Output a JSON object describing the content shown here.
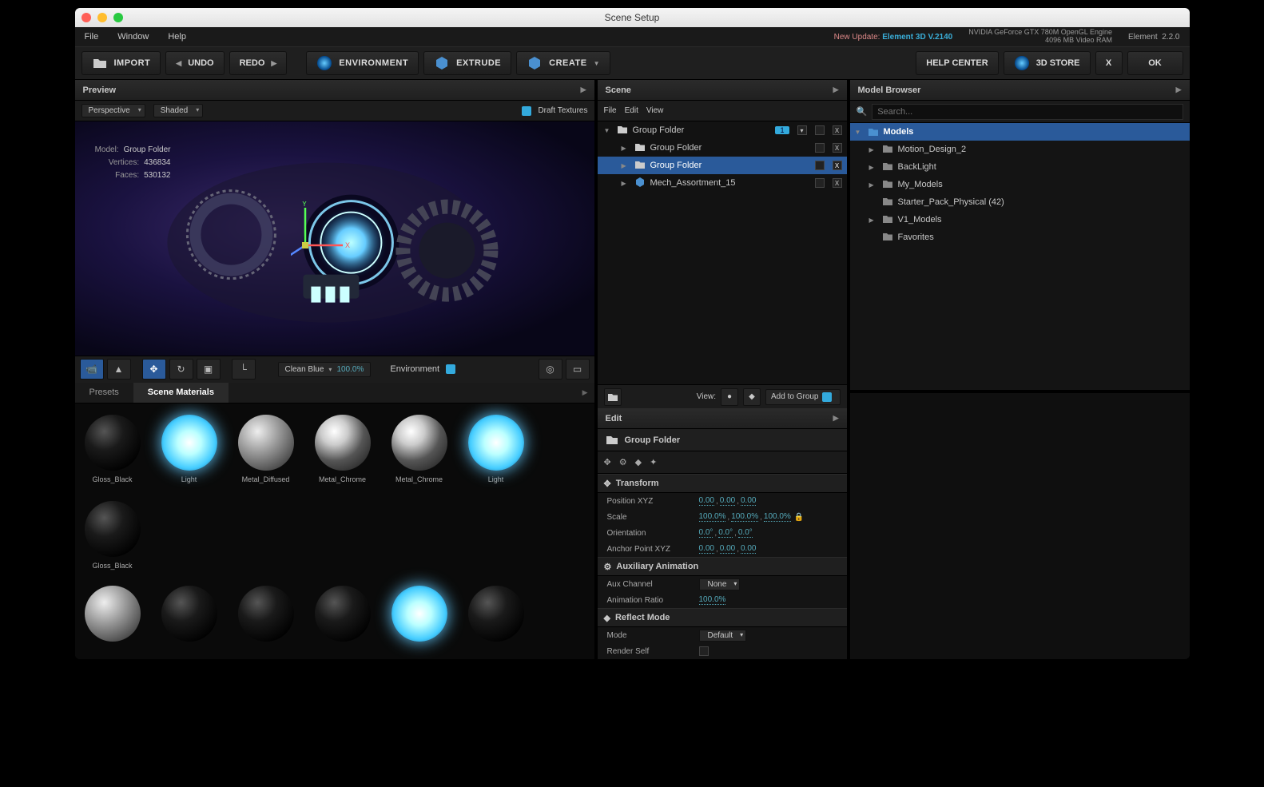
{
  "titlebar": {
    "title": "Scene Setup"
  },
  "menubar": {
    "items": [
      "File",
      "Window",
      "Help"
    ],
    "update_prefix": "New Update:",
    "update_link": "Element 3D V.2140",
    "gpu_line1": "NVIDIA GeForce GTX 780M OpenGL Engine",
    "gpu_line2": "4096 MB Video RAM",
    "app_name": "Element",
    "app_ver": "2.2.0"
  },
  "toolbar": {
    "import": "IMPORT",
    "undo": "UNDO",
    "redo": "REDO",
    "environment": "ENVIRONMENT",
    "extrude": "EXTRUDE",
    "create": "CREATE",
    "help": "HELP CENTER",
    "store": "3D STORE",
    "x": "X",
    "ok": "OK"
  },
  "preview": {
    "title": "Preview",
    "view_mode": "Perspective",
    "shade_mode": "Shaded",
    "draft_tex": "Draft Textures",
    "info": {
      "model_lbl": "Model:",
      "model": "Group Folder",
      "verts_lbl": "Vertices:",
      "verts": "436834",
      "faces_lbl": "Faces:",
      "faces": "530132"
    },
    "env_preset": "Clean Blue",
    "env_pct": "100.0%",
    "env_label": "Environment"
  },
  "materials": {
    "tab_presets": "Presets",
    "tab_scene": "Scene Materials",
    "row1": [
      "Gloss_Black",
      "Light",
      "Metal_Diffused",
      "Metal_Chrome",
      "Metal_Chrome",
      "Light",
      "Gloss_Black"
    ],
    "row2": [
      "",
      "",
      "",
      "",
      "",
      "",
      ""
    ]
  },
  "scene": {
    "title": "Scene",
    "menus": [
      "File",
      "Edit",
      "View"
    ],
    "tree": [
      {
        "label": "Group Folder",
        "depth": 0,
        "expanded": true,
        "badge": "1",
        "folder": true
      },
      {
        "label": "Group Folder",
        "depth": 1,
        "folder": true
      },
      {
        "label": "Group Folder",
        "depth": 1,
        "folder": true,
        "selected": true
      },
      {
        "label": "Mech_Assortment_15",
        "depth": 1,
        "cube": true
      }
    ],
    "view_label": "View:",
    "add_to_group": "Add to Group"
  },
  "edit": {
    "title": "Edit",
    "header": "Group Folder",
    "transform": {
      "title": "Transform",
      "pos_lbl": "Position XYZ",
      "pos": [
        "0.00",
        "0.00",
        "0.00"
      ],
      "scale_lbl": "Scale",
      "scale": [
        "100.0%",
        "100.0%",
        "100.0%"
      ],
      "orient_lbl": "Orientation",
      "orient": [
        "0.0°",
        "0.0°",
        "0.0°"
      ],
      "anchor_lbl": "Anchor Point XYZ",
      "anchor": [
        "0.00",
        "0.00",
        "0.00"
      ]
    },
    "aux": {
      "title": "Auxiliary Animation",
      "channel_lbl": "Aux Channel",
      "channel": "None",
      "ratio_lbl": "Animation Ratio",
      "ratio": "100.0%"
    },
    "reflect": {
      "title": "Reflect Mode",
      "mode_lbl": "Mode",
      "mode": "Default",
      "self_lbl": "Render Self"
    }
  },
  "browser": {
    "title": "Model Browser",
    "search_ph": "Search...",
    "root": "Models",
    "items": [
      {
        "label": "Motion_Design_2",
        "tri": true
      },
      {
        "label": "BackLight",
        "tri": true
      },
      {
        "label": "My_Models",
        "tri": true
      },
      {
        "label": "Starter_Pack_Physical (42)",
        "tri": false
      },
      {
        "label": "V1_Models",
        "tri": true
      },
      {
        "label": "Favorites",
        "tri": false
      }
    ]
  }
}
